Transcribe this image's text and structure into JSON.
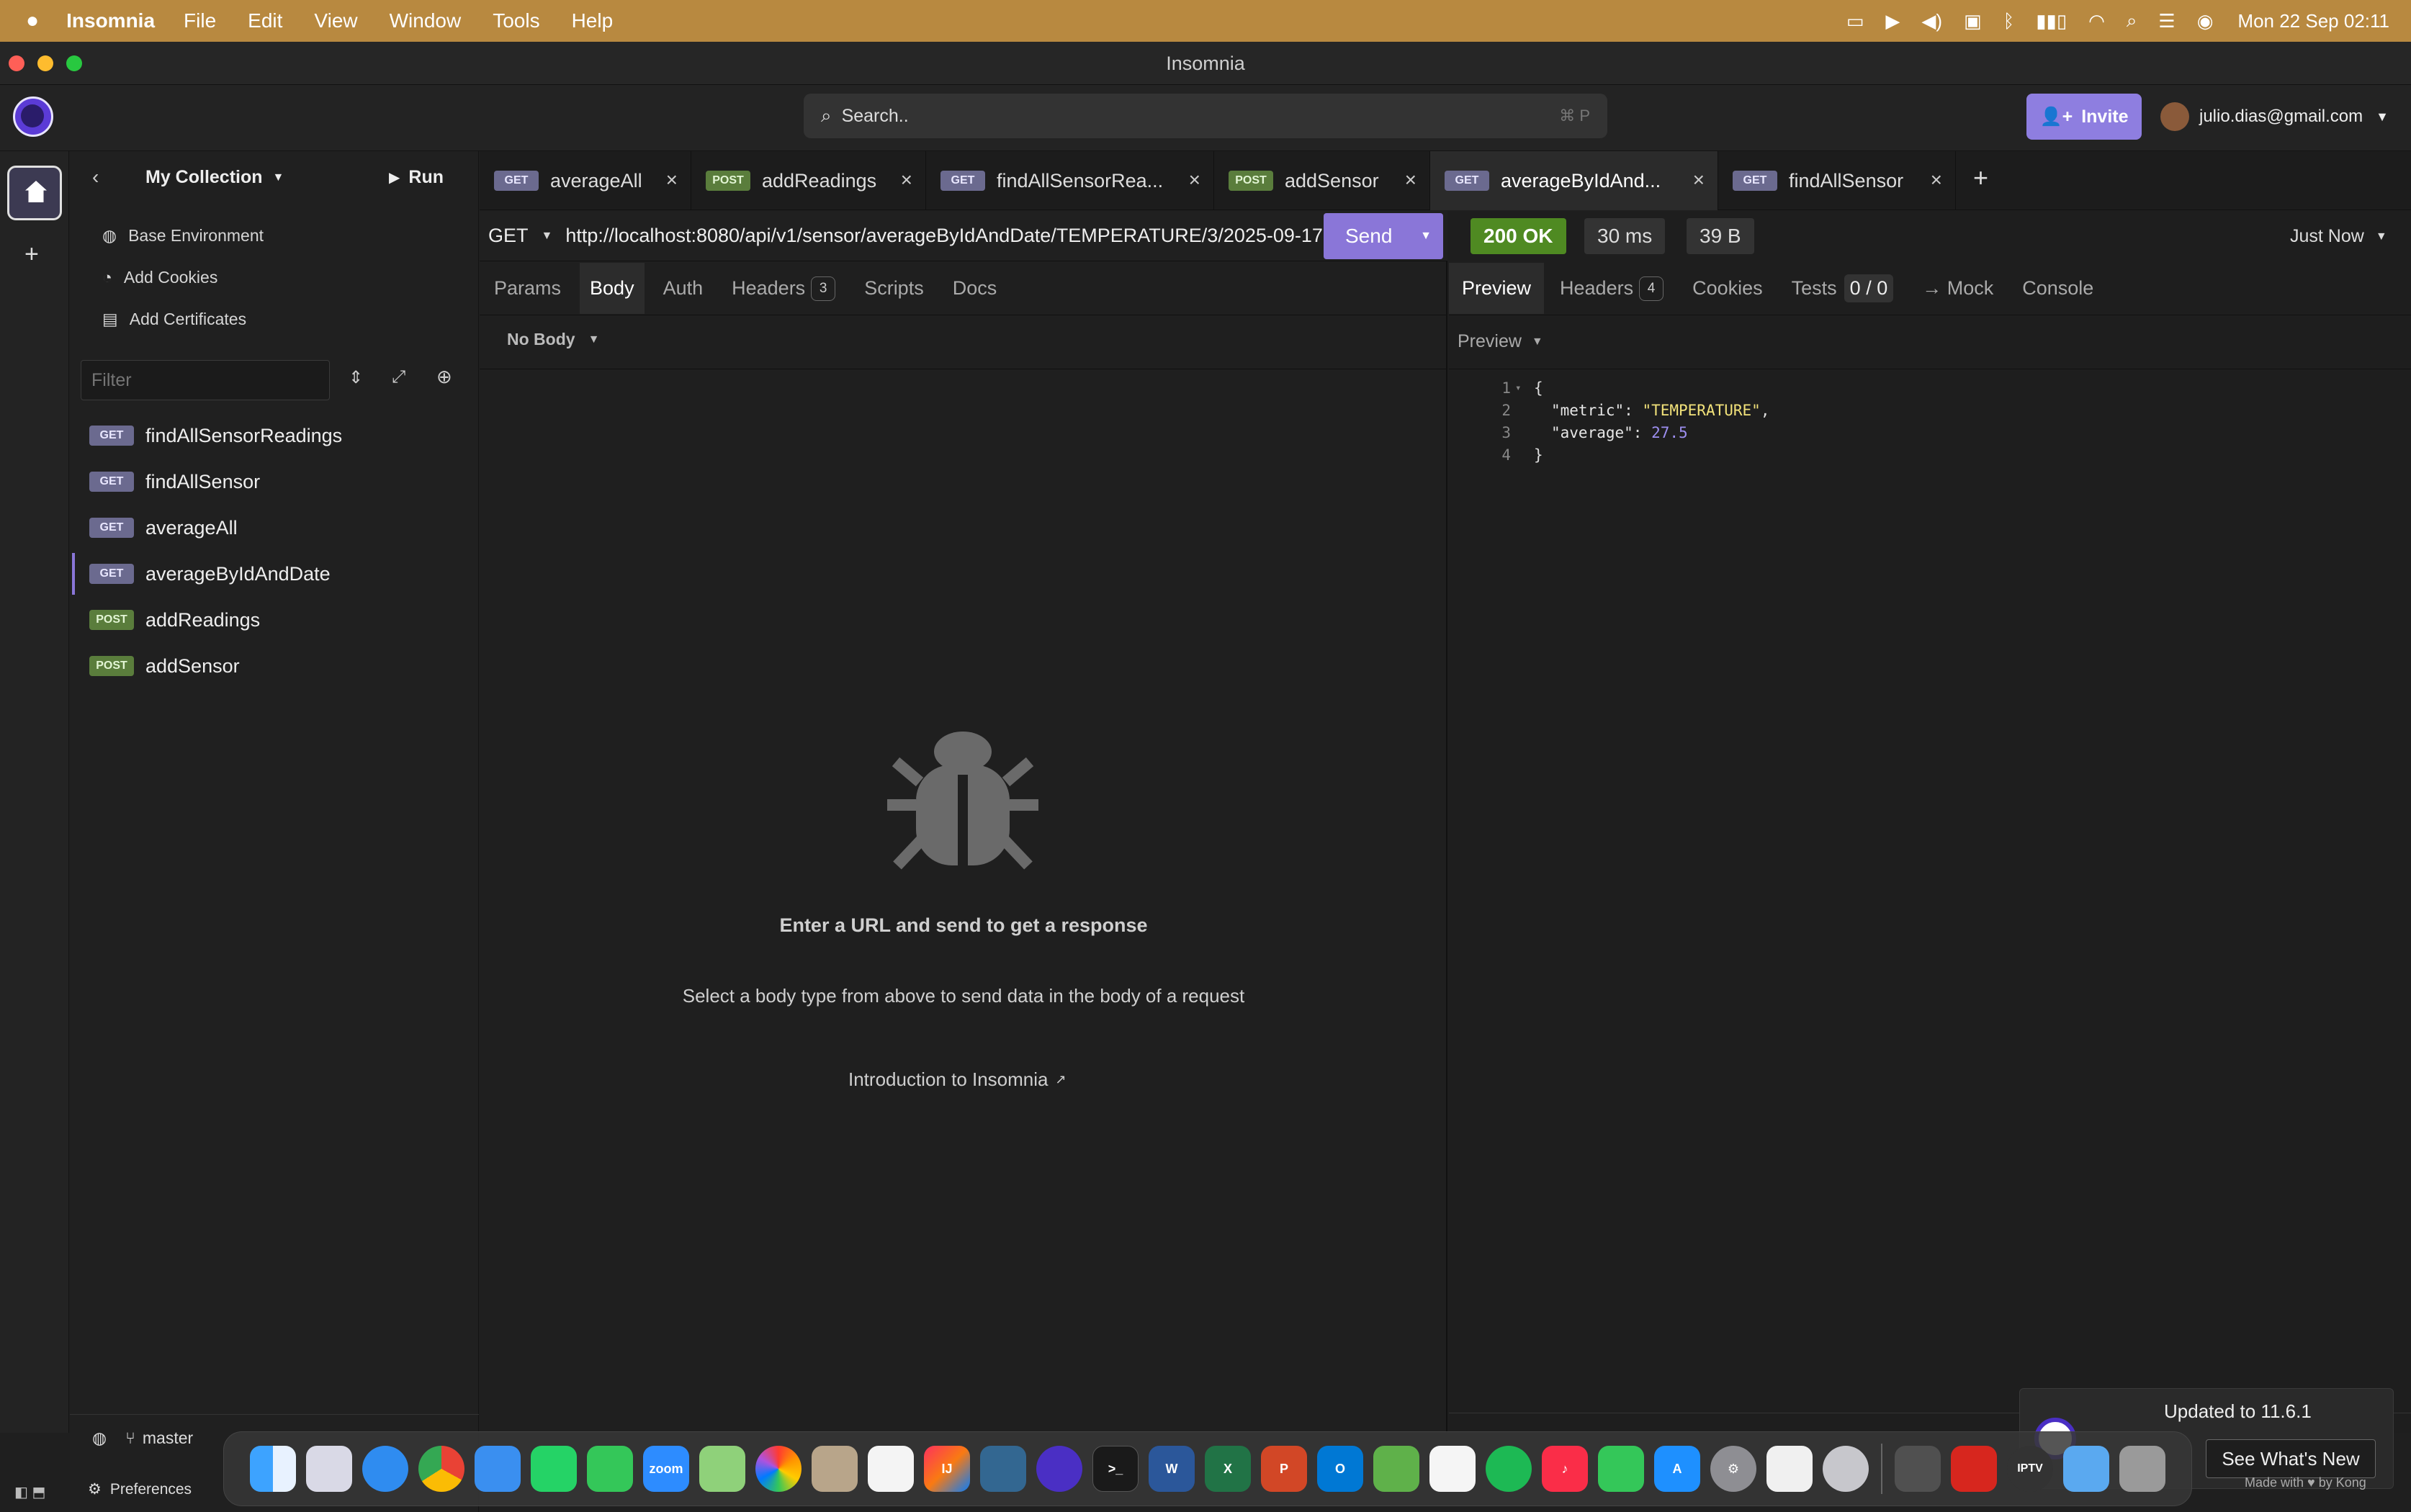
{
  "menubar": {
    "app_name": "Insomnia",
    "items": [
      "File",
      "Edit",
      "View",
      "Window",
      "Tools",
      "Help"
    ],
    "clock": "Mon 22 Sep  02:11"
  },
  "window": {
    "title": "Insomnia"
  },
  "topbar": {
    "search_placeholder": "Search..",
    "search_shortcut": "⌘ P",
    "invite_label": "Invite",
    "user_email": "julio.dias@gmail.com"
  },
  "sidebar": {
    "collection_name": "My Collection",
    "run_label": "Run",
    "links": [
      "Base Environment",
      "Add Cookies",
      "Add Certificates"
    ],
    "filter_placeholder": "Filter",
    "requests": [
      {
        "method": "GET",
        "name": "findAllSensorReadings"
      },
      {
        "method": "GET",
        "name": "findAllSensor"
      },
      {
        "method": "GET",
        "name": "averageAll"
      },
      {
        "method": "GET",
        "name": "averageByIdAndDate"
      },
      {
        "method": "POST",
        "name": "addReadings"
      },
      {
        "method": "POST",
        "name": "addSensor"
      }
    ],
    "branch": "master",
    "preferences_label": "Preferences"
  },
  "tabs": [
    {
      "method": "GET",
      "name": "averageAll"
    },
    {
      "method": "POST",
      "name": "addReadings"
    },
    {
      "method": "GET",
      "name": "findAllSensorRea..."
    },
    {
      "method": "POST",
      "name": "addSensor"
    },
    {
      "method": "GET",
      "name": "averageByIdAnd..."
    },
    {
      "method": "GET",
      "name": "findAllSensor"
    }
  ],
  "request": {
    "method": "GET",
    "url": "http://localhost:8080/api/v1/sensor/averageByIdAndDate/TEMPERATURE/3/2025-09-17",
    "send_label": "Send",
    "subtabs": {
      "params": "Params",
      "body": "Body",
      "auth": "Auth",
      "headers": "Headers",
      "headers_count": "3",
      "scripts": "Scripts",
      "docs": "Docs"
    },
    "body_type": "No Body",
    "empty_title": "Enter a URL and send to get a response",
    "empty_hint": "Select a body type from above to send data in the body of a request",
    "intro_link": "Introduction to Insomnia"
  },
  "response": {
    "status": "200 OK",
    "time": "30 ms",
    "size": "39 B",
    "timestamp": "Just Now",
    "subtabs": {
      "preview": "Preview",
      "headers": "Headers",
      "headers_count": "4",
      "cookies": "Cookies",
      "tests": "Tests",
      "tests_count": "0 / 0",
      "mock": "→ Mock",
      "console": "Console"
    },
    "preview_mode": "Preview",
    "lines": [
      {
        "n": "1",
        "text": "{"
      },
      {
        "n": "2",
        "key": "\"metric\"",
        "sep": ": ",
        "val": "\"TEMPERATURE\"",
        "tail": ","
      },
      {
        "n": "3",
        "key": "\"average\"",
        "sep": ": ",
        "num": "27.5",
        "tail": ""
      },
      {
        "n": "4",
        "text": "}"
      }
    ]
  },
  "toast": {
    "title": "Updated to 11.6.1",
    "button": "See What's New",
    "footer": "Made with ♥ by Kong"
  },
  "dock": {
    "apps": [
      "Finder",
      "Launchpad",
      "Safari",
      "Chrome",
      "Mail",
      "WhatsApp",
      "FaceTime",
      "Zoom",
      "Maps",
      "Photos",
      "Contacts",
      "Reminders",
      "IntelliJ",
      "Postgres",
      "Insomnia",
      "Terminal",
      "Word",
      "Excel",
      "PowerPoint",
      "Outlook",
      "Cloud",
      "Notes",
      "Spotify",
      "Music",
      "Numbers",
      "App Store",
      "Settings",
      "Freeform",
      "Drive",
      "Calculator",
      "Acrobat",
      "IPTV",
      "Folder",
      "Trash"
    ],
    "labels": {
      "zoom": "zoom",
      "iptv": "IPTV",
      "word": "W",
      "excel": "X",
      "ppt": "P",
      "outlook": "O",
      "intellij": "IJ"
    }
  }
}
